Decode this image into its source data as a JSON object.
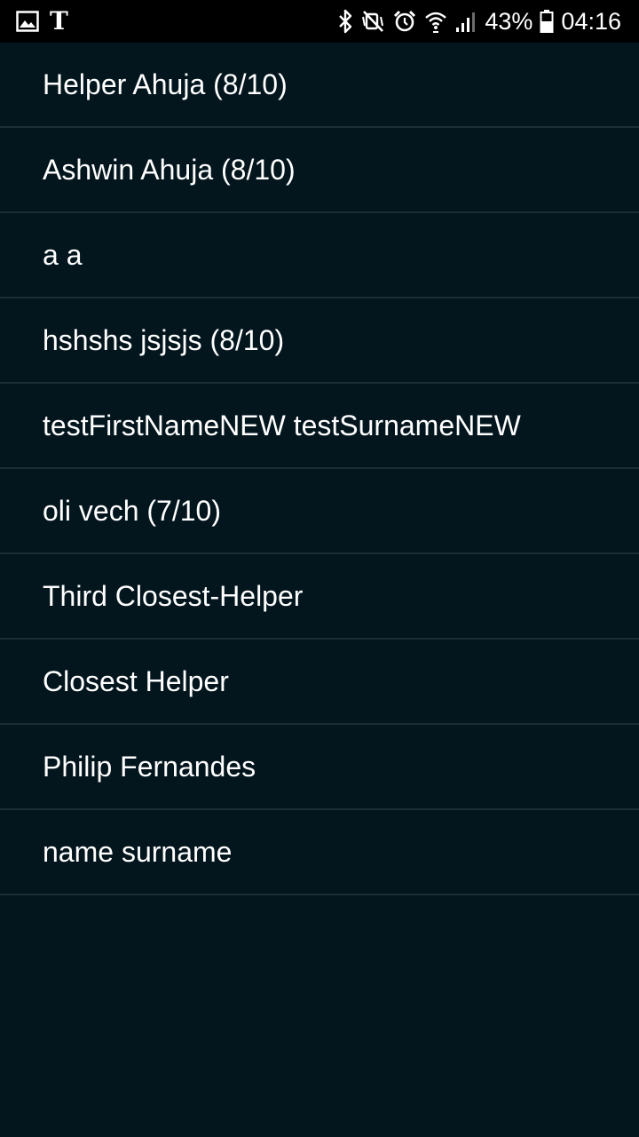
{
  "status_bar": {
    "battery_percent": "43%",
    "time": "04:16",
    "left_icons": [
      "gallery-icon",
      "nyt-icon"
    ],
    "right_icons": [
      "bluetooth-icon",
      "mute-icon",
      "alarm-icon",
      "wifi-icon",
      "signal-icon",
      "battery-icon"
    ],
    "nyt_glyph": "T"
  },
  "helpers": {
    "items": [
      {
        "label": "Helper Ahuja (8/10)"
      },
      {
        "label": "Ashwin Ahuja (8/10)"
      },
      {
        "label": "a a"
      },
      {
        "label": "hshshs jsjsjs (8/10)"
      },
      {
        "label": "testFirstNameNEW testSurnameNEW"
      },
      {
        "label": "oli vech (7/10)"
      },
      {
        "label": "Third Closest-Helper"
      },
      {
        "label": "Closest Helper"
      },
      {
        "label": "Philip Fernandes"
      },
      {
        "label": "name surname"
      }
    ]
  }
}
